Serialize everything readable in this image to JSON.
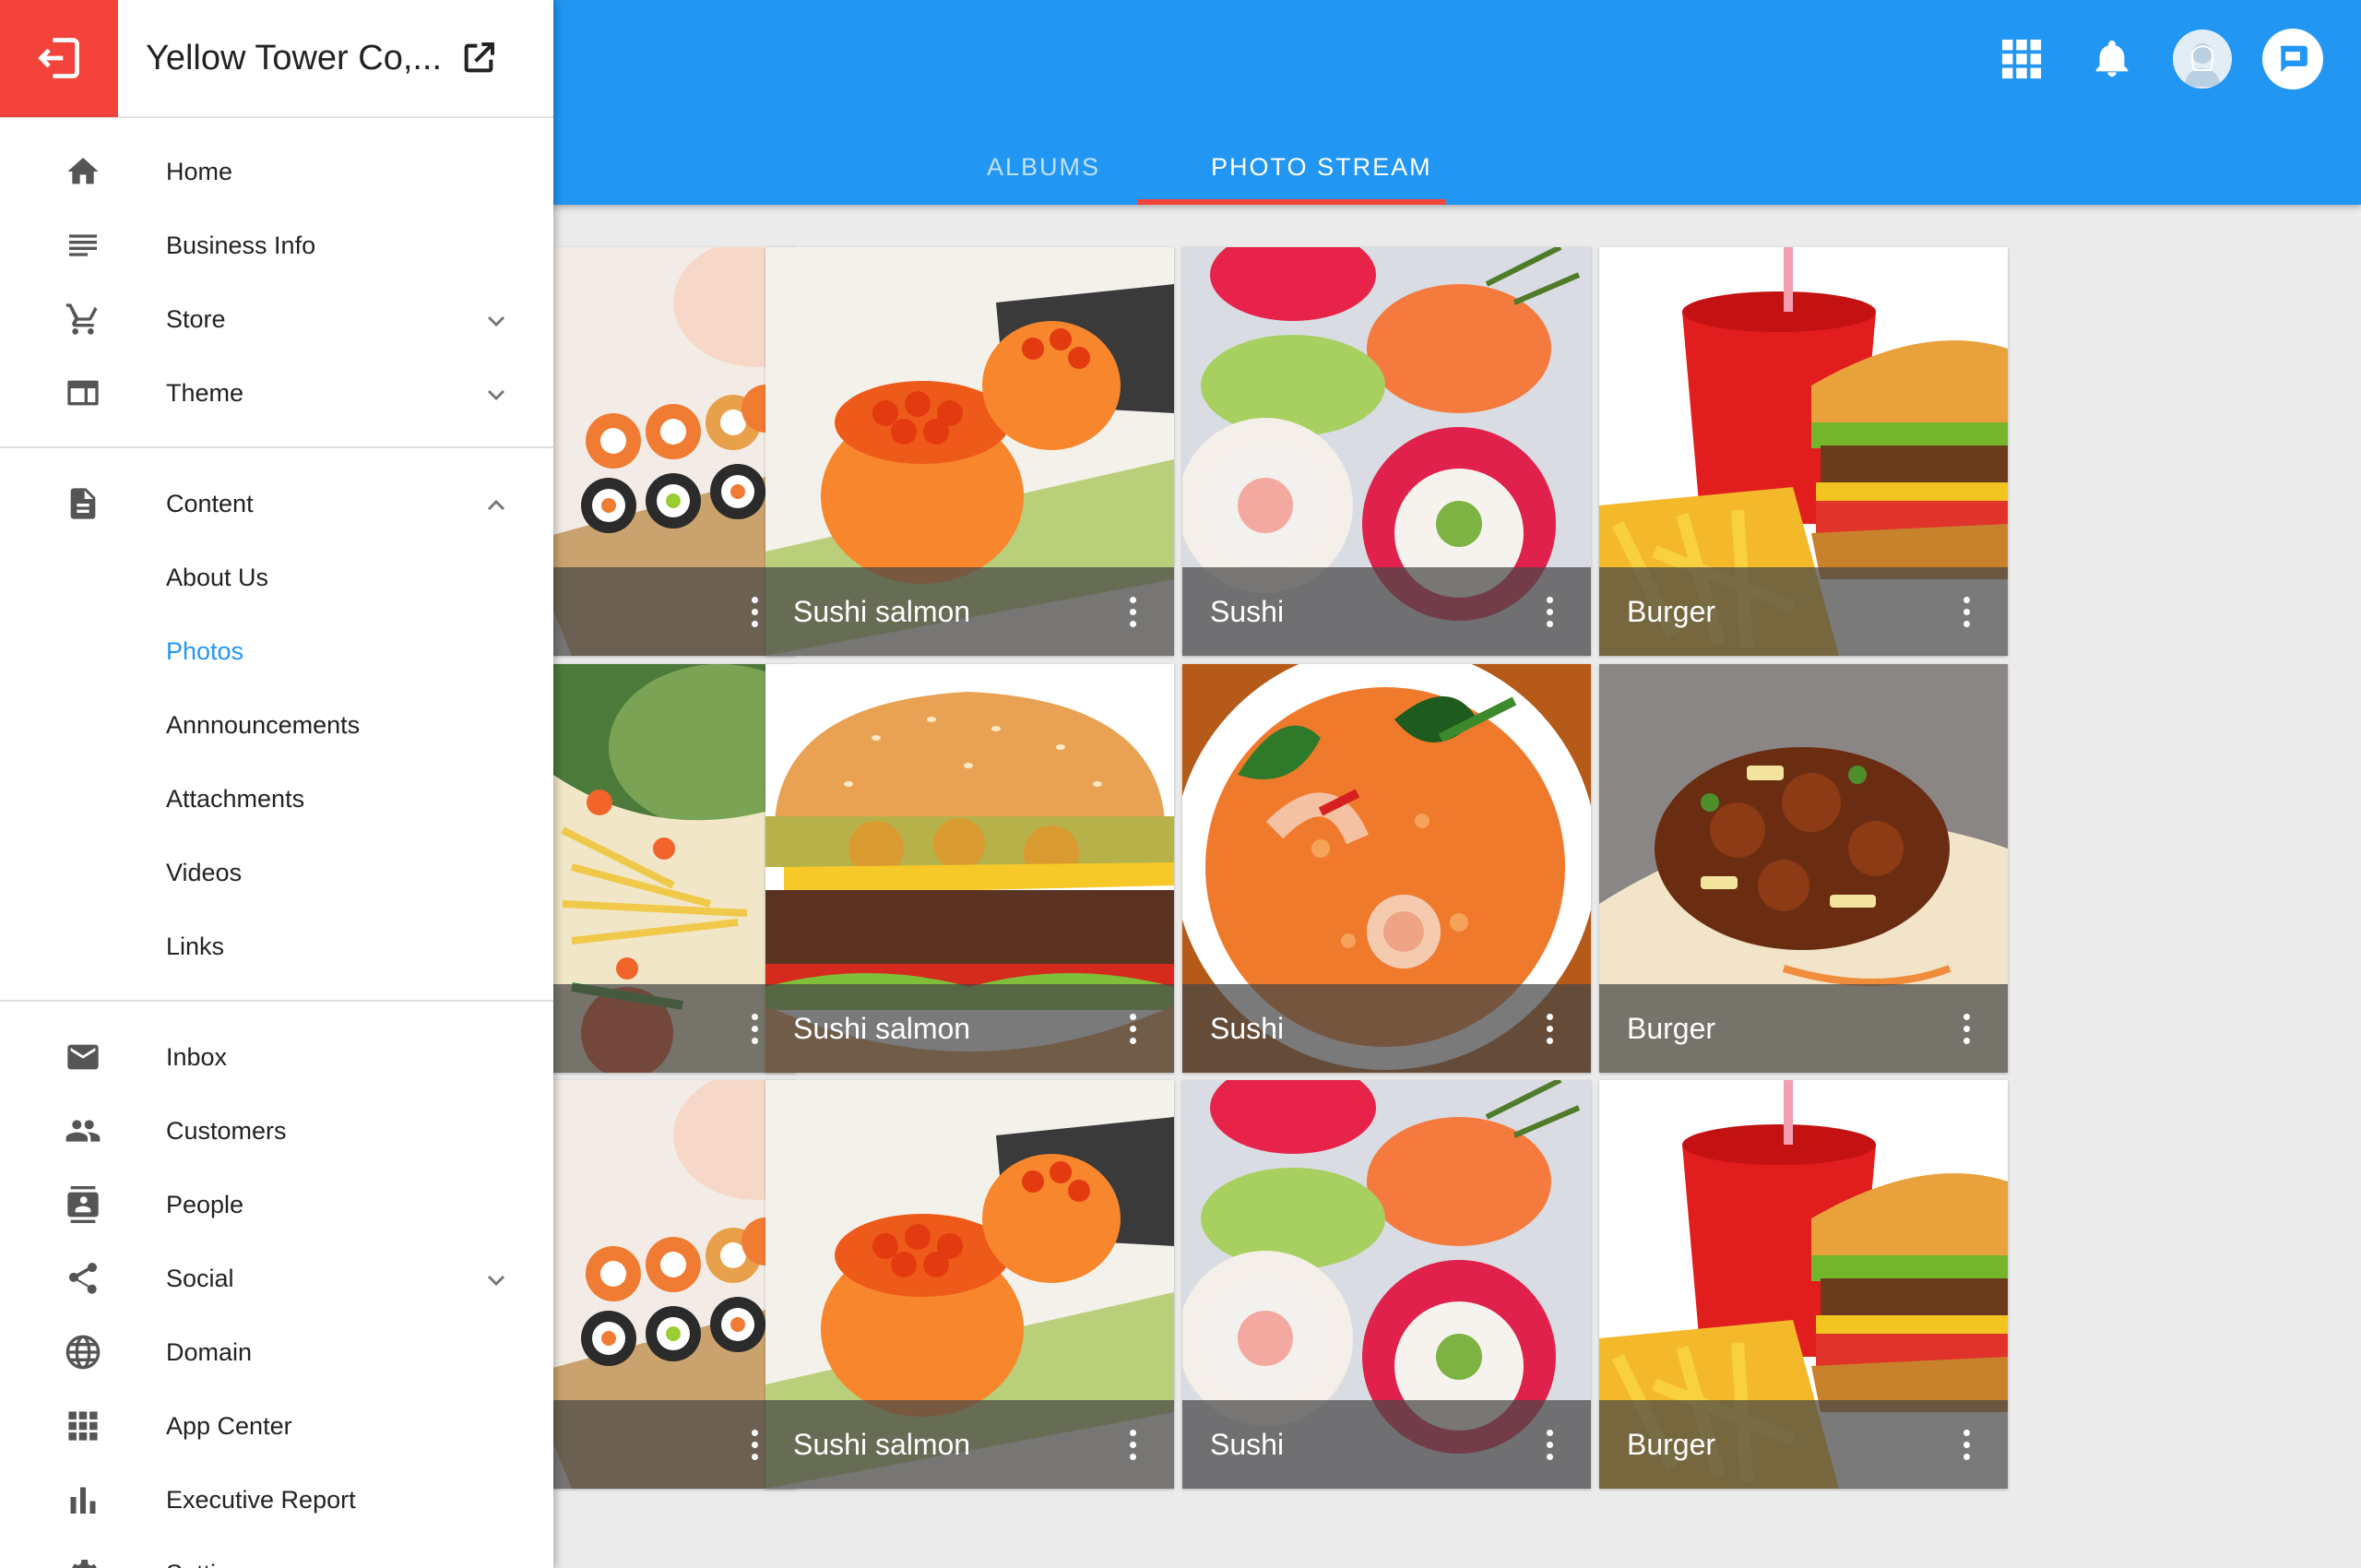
{
  "sidebar": {
    "business_name": "Yellow Tower Co,...",
    "groups": [
      [
        {
          "label": "Home",
          "icon": "home-icon"
        },
        {
          "label": "Business Info",
          "icon": "list-icon"
        },
        {
          "label": "Store",
          "icon": "cart-icon",
          "chevron": "down"
        },
        {
          "label": "Theme",
          "icon": "theme-icon",
          "chevron": "down"
        }
      ],
      [
        {
          "label": "Content",
          "icon": "document-icon",
          "chevron": "up"
        }
      ],
      [
        {
          "label": "Inbox",
          "icon": "mail-icon"
        },
        {
          "label": "Customers",
          "icon": "people-icon"
        },
        {
          "label": "People",
          "icon": "contact-icon"
        },
        {
          "label": "Social",
          "icon": "share-icon",
          "chevron": "down"
        },
        {
          "label": "Domain",
          "icon": "globe-icon"
        },
        {
          "label": "App Center",
          "icon": "apps-icon"
        },
        {
          "label": "Executive Report",
          "icon": "bar-chart-icon"
        },
        {
          "label": "Setting",
          "icon": "gear-icon"
        }
      ]
    ],
    "content_sub": [
      "About Us",
      "Photos",
      "Annnouncements",
      "Attachments",
      "Videos",
      "Links"
    ],
    "active_sub": "Photos"
  },
  "header": {
    "tabs": [
      "ALBUMS",
      "PHOTO STREAM"
    ],
    "active_tab": "PHOTO STREAM",
    "icons": [
      "apps-grid-icon",
      "bell-icon",
      "avatar",
      "chat-icon"
    ]
  },
  "photos": [
    {
      "caption": "",
      "image": "sushi-rolls"
    },
    {
      "caption": "Sushi salmon",
      "image": "salmon-roe-sushi"
    },
    {
      "caption": "Sushi",
      "image": "tuna-rolls"
    },
    {
      "caption": "Burger",
      "image": "burger-fries-drink"
    },
    {
      "caption": "",
      "image": "papaya-salad"
    },
    {
      "caption": "Sushi salmon",
      "image": "burger"
    },
    {
      "caption": "Sushi",
      "image": "tom-yum-soup"
    },
    {
      "caption": "Burger",
      "image": "stir-fry"
    },
    {
      "caption": "",
      "image": "sushi-rolls"
    },
    {
      "caption": "Sushi salmon",
      "image": "salmon-roe-sushi"
    },
    {
      "caption": "Sushi",
      "image": "tuna-rolls"
    },
    {
      "caption": "Burger",
      "image": "burger-fries-drink"
    }
  ],
  "colors": {
    "primary": "#2196f3",
    "accent": "#f4433a",
    "active_link": "#2196f3"
  }
}
